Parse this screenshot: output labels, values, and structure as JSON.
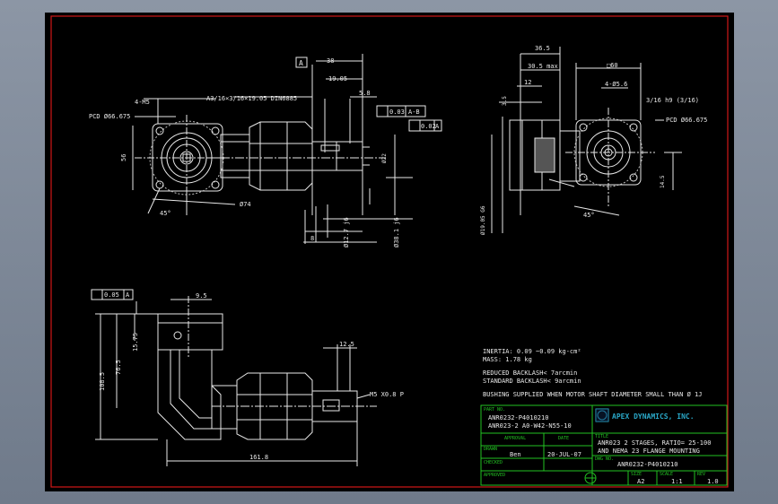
{
  "dims": {
    "d1": "4-M5",
    "d2": "PCD Ø66.675",
    "d3": "A3/16×3/16×19.05 DIN6885",
    "d4": "38",
    "d5": "19.05",
    "d6": "5.8",
    "d7": "0.03",
    "d8": "A-B",
    "d9": "0.02",
    "d10": "A",
    "d11": "36.5",
    "d12": "30.5 max",
    "d13": "□60",
    "d14": "3.5",
    "d15": "12",
    "d16": "4-Ø5.6",
    "d17": "3/16 h9 (3/16)",
    "d18": "PCD Ø66.675",
    "d19": "45°",
    "d20": "Ø74",
    "d21": "Ø12.7 j6",
    "d22": "Ø38.1 j6",
    "d23": "Ø19.05 G6",
    "d24": "45°",
    "d25": "0.05",
    "d26": "A",
    "d27": "9.5",
    "d28": "76.5",
    "d29": "15.75",
    "d30": "108.5",
    "d31": "161.8",
    "d32": "M5 X0.8 P",
    "d33": "12.5",
    "d34": "8"
  },
  "tol_box_frame": "A",
  "notes": {
    "inertia": "INERTIA: 0.09 ~0.09 kg-cm²",
    "mass": "MASS: 1.78 kg",
    "reduced": "REDUCED BACKLASH< 7arcmin",
    "standard": "STANDARD BACKLASH< 9arcmin",
    "bushing": "BUSHING SUPPLIED WHEN MOTOR SHAFT DIAMETER SMALL THAN Ø 1J"
  },
  "title_block": {
    "part_no_label": "PART NO.",
    "part_no_1": "ANR0232-P4010210",
    "part_no_2": "ANR023-2 A0-W42-N55-10",
    "approval_label": "APPROVAL",
    "date_label": "DATE",
    "drawn_label": "DRAWN",
    "drawn_by": "Ben",
    "drawn_date": "20-JUL-07",
    "checked_label": "CHECKED",
    "approved_label": "APPROVED",
    "company": "APEX DYNAMICS, INC.",
    "title_label": "TITLE",
    "title_line1": "ANR023 2 STAGES, RATIO= 25-100",
    "title_line2": "AND NEMA 23 FLANGE MOUNTING",
    "dwg_no_label": "DWG NO.",
    "dwg_no": "ANR0232-P4010210",
    "size_label": "SIZE",
    "size": "A2",
    "scale_label": "SCALE",
    "scale": "1:1",
    "rev_label": "REV",
    "rev": "1.0"
  }
}
